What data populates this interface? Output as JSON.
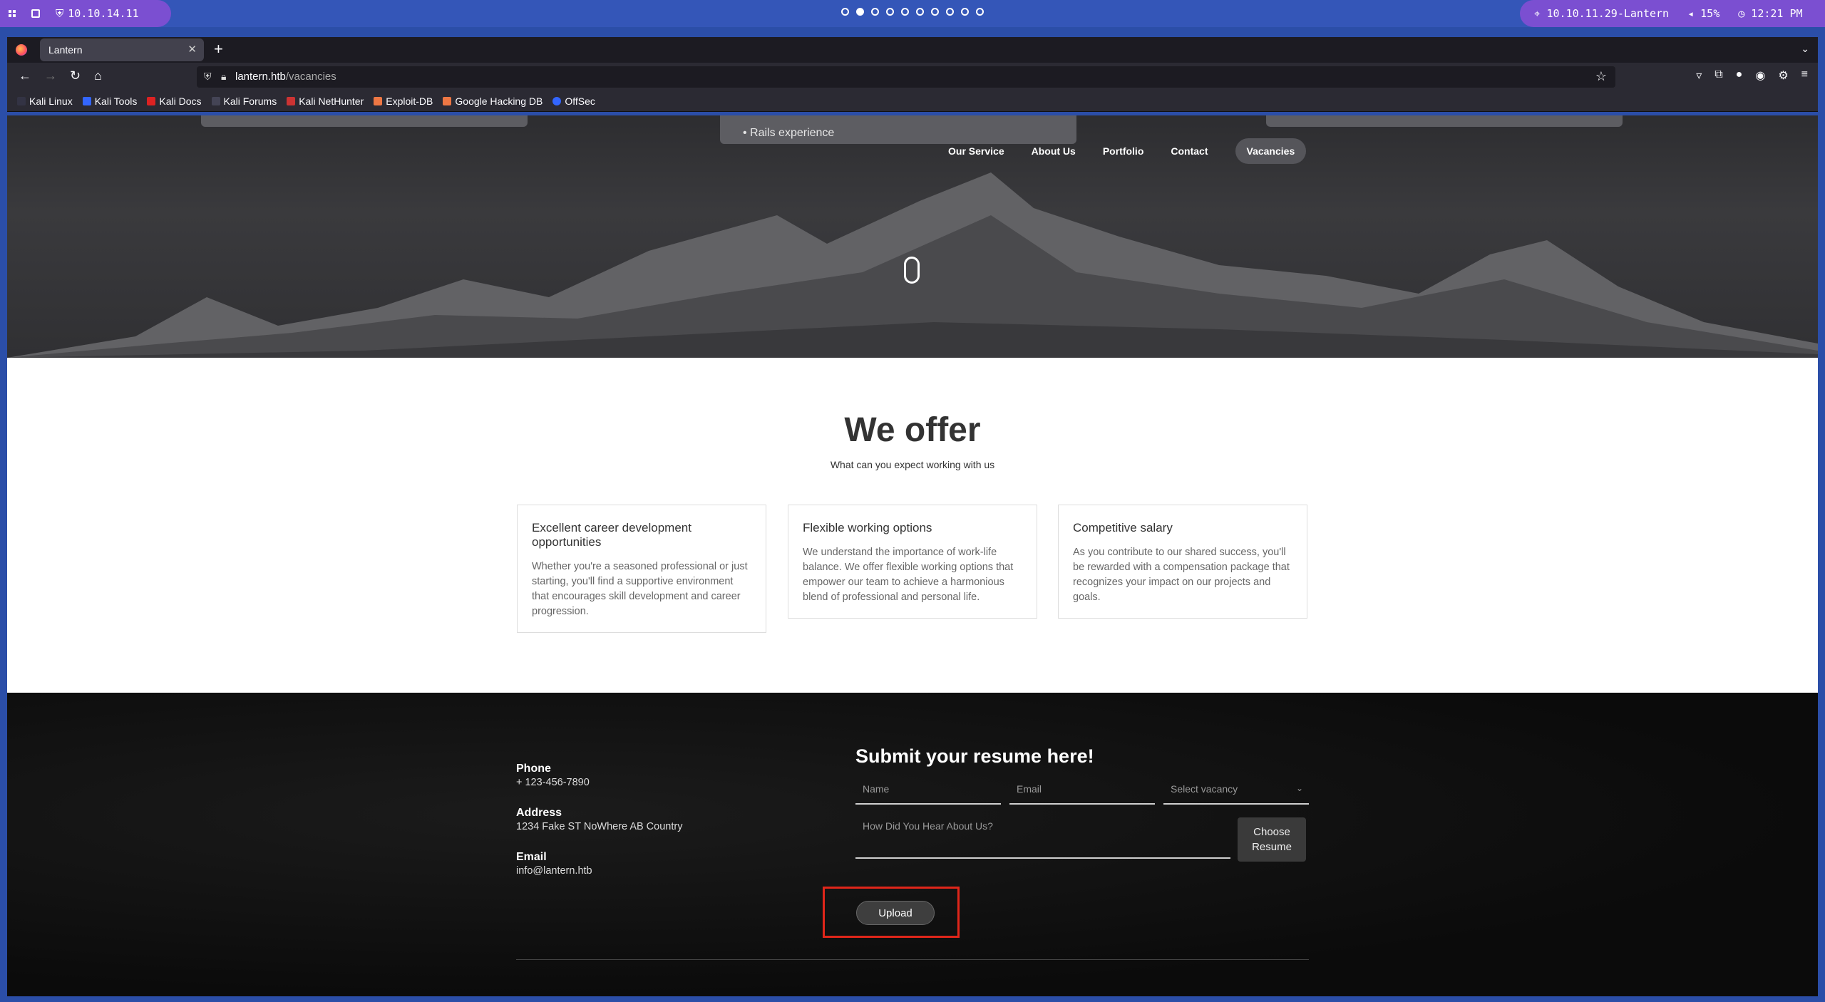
{
  "system": {
    "ip": "10.10.14.11",
    "vpn_target": "10.10.11.29-Lantern",
    "volume": "15%",
    "time": "12:21 PM",
    "workspaces": 10,
    "active_workspace": 2
  },
  "browser": {
    "tab_title": "Lantern",
    "url_host": "lantern.htb",
    "url_path": "/vacancies",
    "bookmarks": [
      "Kali Linux",
      "Kali Tools",
      "Kali Docs",
      "Kali Forums",
      "Kali NetHunter",
      "Exploit-DB",
      "Google Hacking DB",
      "OffSec"
    ]
  },
  "hero": {
    "dropdown_text": "Rails experience",
    "nav": [
      "Our Service",
      "About Us",
      "Portfolio",
      "Contact",
      "Vacancies"
    ]
  },
  "offer": {
    "title": "We offer",
    "subtitle": "What can you expect working with us",
    "cards": [
      {
        "title": "Excellent career development opportunities",
        "text": "Whether you're a seasoned professional or just starting, you'll find a supportive environment that encourages skill development and career progression."
      },
      {
        "title": "Flexible working options",
        "text": "We understand the importance of work-life balance. We offer flexible working options that empower our team to achieve a harmonious blend of professional and personal life."
      },
      {
        "title": "Competitive salary",
        "text": "As you contribute to our shared success, you'll be rewarded with a compensation package that recognizes your impact on our projects and goals."
      }
    ]
  },
  "footer": {
    "phone_label": "Phone",
    "phone": "+ 123-456-7890",
    "address_label": "Address",
    "address": "1234 Fake ST NoWhere AB Country",
    "email_label": "Email",
    "email": "info@lantern.htb",
    "form_title": "Submit your resume here!",
    "name_placeholder": "Name",
    "email_placeholder": "Email",
    "vacancy_placeholder": "Select vacancy",
    "hear_placeholder": "How Did You Hear About Us?",
    "choose_label": "Choose Resume",
    "upload_label": "Upload"
  }
}
